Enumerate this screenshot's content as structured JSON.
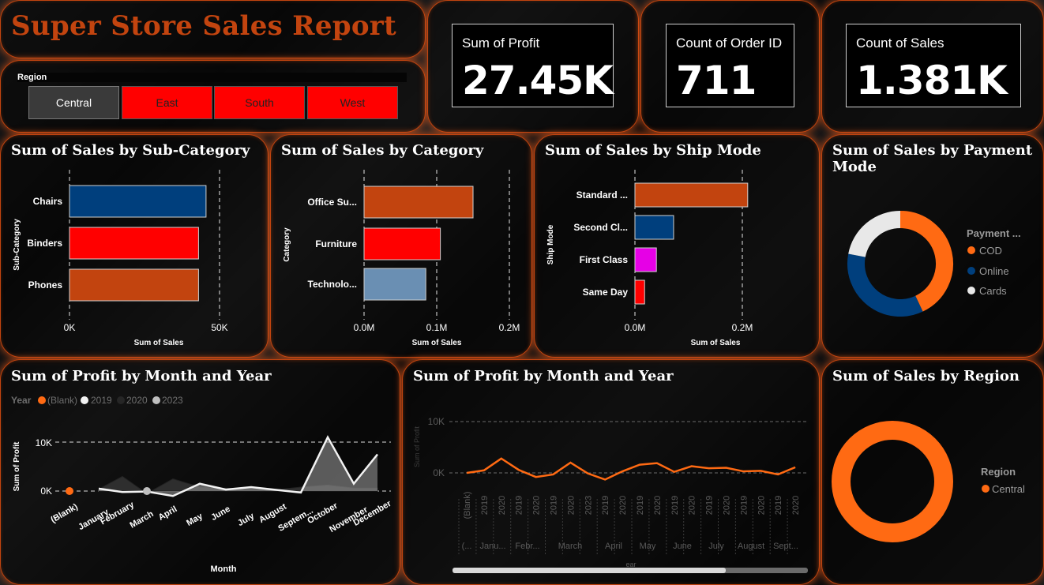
{
  "report": {
    "title": "Super Store Sales Report"
  },
  "slicer": {
    "label": "Region",
    "options": [
      "Central",
      "East",
      "South",
      "West"
    ],
    "selected": "Central"
  },
  "kpis": [
    {
      "label": "Sum of Profit",
      "value": "27.45K"
    },
    {
      "label": "Count of Order ID",
      "value": "711"
    },
    {
      "label": "Count of Sales",
      "value": "1.381K"
    }
  ],
  "colors": {
    "accent": "#c2440f",
    "orange": "#ff6a13",
    "navy": "#003f7d",
    "red": "#ff0000",
    "magenta": "#e600e6",
    "steel": "#6a8fb3",
    "burnt": "#c2440f",
    "light": "#e8e8e8"
  },
  "charts": {
    "subcategory": {
      "title": "Sum of Sales by Sub-Category",
      "ylabel": "Sub-Category",
      "xlabel": "Sum of Sales",
      "ticks": [
        "0K",
        "50K"
      ]
    },
    "category": {
      "title": "Sum of Sales by Category",
      "ylabel": "Category",
      "xlabel": "Sum of Sales",
      "ticks": [
        "0.0M",
        "0.1M",
        "0.2M"
      ]
    },
    "shipmode": {
      "title": "Sum of Sales by Ship Mode",
      "ylabel": "Ship Mode",
      "xlabel": "Sum of Sales",
      "ticks": [
        "0.0M",
        "0.2M"
      ]
    },
    "payment": {
      "title": "Sum of Sales by Payment Mode",
      "legend_title": "Payment ...",
      "legend": [
        "COD",
        "Online",
        "Cards"
      ]
    },
    "profit_month": {
      "title": "Sum of Profit by Month and Year",
      "legend_title": "Year",
      "legend": [
        "(Blank)",
        "2019",
        "2020",
        "2023"
      ],
      "ylabel": "Sum of Profit",
      "xlabel": "Month",
      "yticks": [
        "10K",
        "0K"
      ]
    },
    "profit_month2": {
      "title": "Sum of Profit by Month and Year",
      "ylabel": "Sum of Profit",
      "yticks": [
        "10K",
        "0K"
      ],
      "year_ticks": [
        "(Blank)",
        "2019",
        "2020",
        "2019",
        "2020",
        "2019",
        "2020",
        "2023",
        "2019",
        "2020",
        "2019",
        "2020",
        "2019",
        "2020",
        "2019",
        "2020",
        "2019",
        "2020",
        "2019",
        "2020"
      ],
      "month_ticks": [
        "(...",
        "Janu...",
        "Febr...",
        "March",
        "April",
        "May",
        "June",
        "July",
        "August",
        "Sept..."
      ],
      "xlabel_partial": "ear"
    },
    "region": {
      "title": "Sum of Sales by Region",
      "legend_title": "Region",
      "legend": [
        "Central"
      ]
    }
  },
  "chart_data": [
    {
      "type": "bar",
      "title": "Sum of Sales by Sub-Category",
      "categories": [
        "Chairs",
        "Binders",
        "Phones"
      ],
      "values": [
        45500,
        43000,
        43000
      ],
      "xlabel": "Sum of Sales",
      "ylabel": "Sub-Category",
      "xlim": [
        0,
        50000
      ],
      "colors": [
        "#003f7d",
        "#ff0000",
        "#c2440f"
      ]
    },
    {
      "type": "bar",
      "title": "Sum of Sales by Category",
      "categories": [
        "Office Su...",
        "Furniture",
        "Technolo..."
      ],
      "values": [
        0.15,
        0.105,
        0.085
      ],
      "xlabel": "Sum of Sales",
      "ylabel": "Category",
      "xlim": [
        0,
        0.2
      ],
      "unit": "M",
      "colors": [
        "#c2440f",
        "#ff0000",
        "#6a8fb3"
      ]
    },
    {
      "type": "bar",
      "title": "Sum of Sales by Ship Mode",
      "categories": [
        "Standard ...",
        "Second Cl...",
        "First Class",
        "Same Day"
      ],
      "values": [
        0.21,
        0.072,
        0.04,
        0.018
      ],
      "xlabel": "Sum of Sales",
      "ylabel": "Ship Mode",
      "xlim": [
        0,
        0.2
      ],
      "unit": "M",
      "colors": [
        "#c2440f",
        "#003f7d",
        "#e600e6",
        "#ff0000"
      ]
    },
    {
      "type": "pie",
      "title": "Sum of Sales by Payment Mode",
      "categories": [
        "COD",
        "Online",
        "Cards"
      ],
      "values": [
        0.43,
        0.35,
        0.22
      ],
      "colors": [
        "#ff6a13",
        "#003f7d",
        "#e8e8e8"
      ]
    },
    {
      "type": "area",
      "title": "Sum of Profit by Month and Year",
      "categories": [
        "(Blank)",
        "January",
        "February",
        "March",
        "April",
        "May",
        "June",
        "July",
        "August",
        "Septem...",
        "October",
        "November",
        "December"
      ],
      "series": [
        {
          "name": "(Blank)",
          "values": [
            0,
            null,
            null,
            null,
            null,
            null,
            null,
            null,
            null,
            null,
            null,
            null,
            null
          ]
        },
        {
          "name": "2019",
          "values": [
            null,
            500,
            -200,
            -100,
            -1000,
            1500,
            300,
            800,
            200,
            -300,
            11000,
            1500,
            7500
          ]
        },
        {
          "name": "2020",
          "values": [
            null,
            400,
            3000,
            -500,
            2500,
            800,
            600,
            400,
            300,
            800,
            1200,
            600,
            600
          ]
        },
        {
          "name": "2023",
          "values": [
            null,
            null,
            null,
            null,
            0,
            null,
            null,
            null,
            null,
            null,
            null,
            null,
            null
          ]
        }
      ],
      "ylabel": "Sum of Profit",
      "xlabel": "Month",
      "yticks": [
        0,
        10000
      ]
    },
    {
      "type": "line",
      "title": "Sum of Profit by Month and Year",
      "values": [
        0,
        500,
        2800,
        600,
        -800,
        -300,
        2000,
        -100,
        -1300,
        300,
        1600,
        1900,
        200,
        1300,
        900,
        1000,
        300,
        400,
        -300,
        1100
      ],
      "ylabel": "Sum of Profit",
      "yticks": [
        0,
        10000
      ]
    },
    {
      "type": "pie",
      "title": "Sum of Sales by Region",
      "categories": [
        "Central"
      ],
      "values": [
        1
      ],
      "colors": [
        "#ff6a13"
      ]
    }
  ]
}
